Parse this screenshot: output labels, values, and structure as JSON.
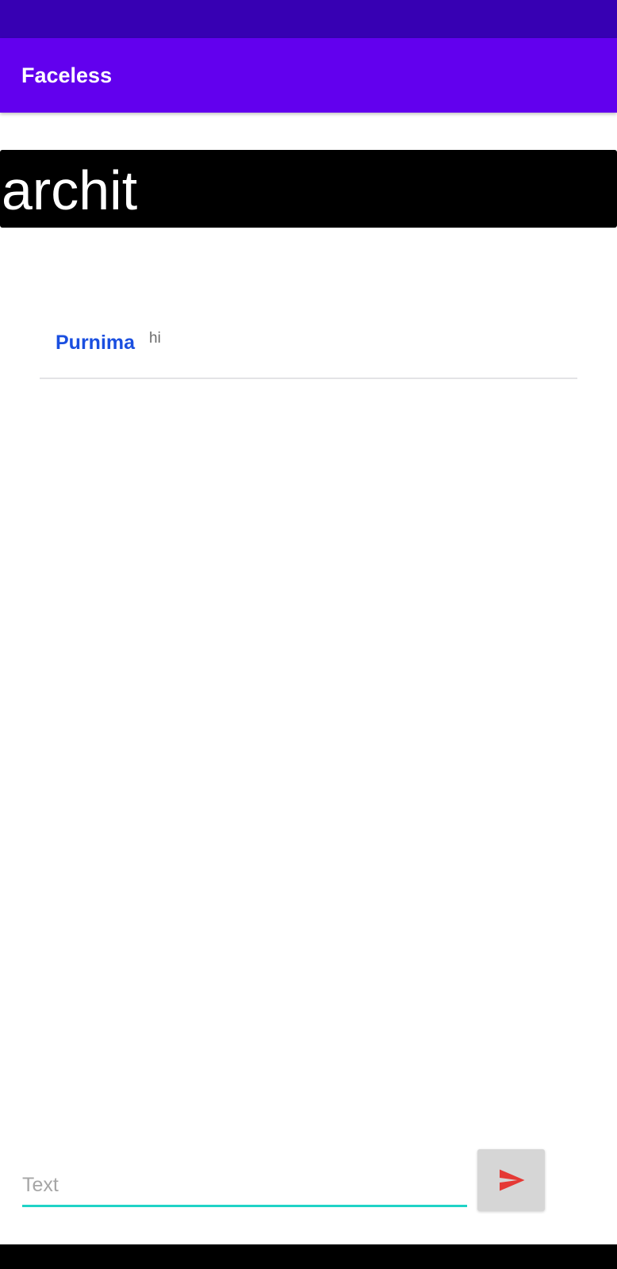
{
  "app": {
    "title": "Faceless"
  },
  "room": {
    "name": "archit"
  },
  "messages": [
    {
      "sender": "Purnima",
      "text": "hi"
    }
  ],
  "composer": {
    "placeholder": "Text",
    "value": "",
    "send_icon": "send-icon"
  },
  "colors": {
    "status_bar": "#3700b3",
    "app_bar": "#6200ee",
    "sender_name": "#1a4fe0",
    "input_underline": "#1fd3c6",
    "send_icon": "#e53935"
  }
}
